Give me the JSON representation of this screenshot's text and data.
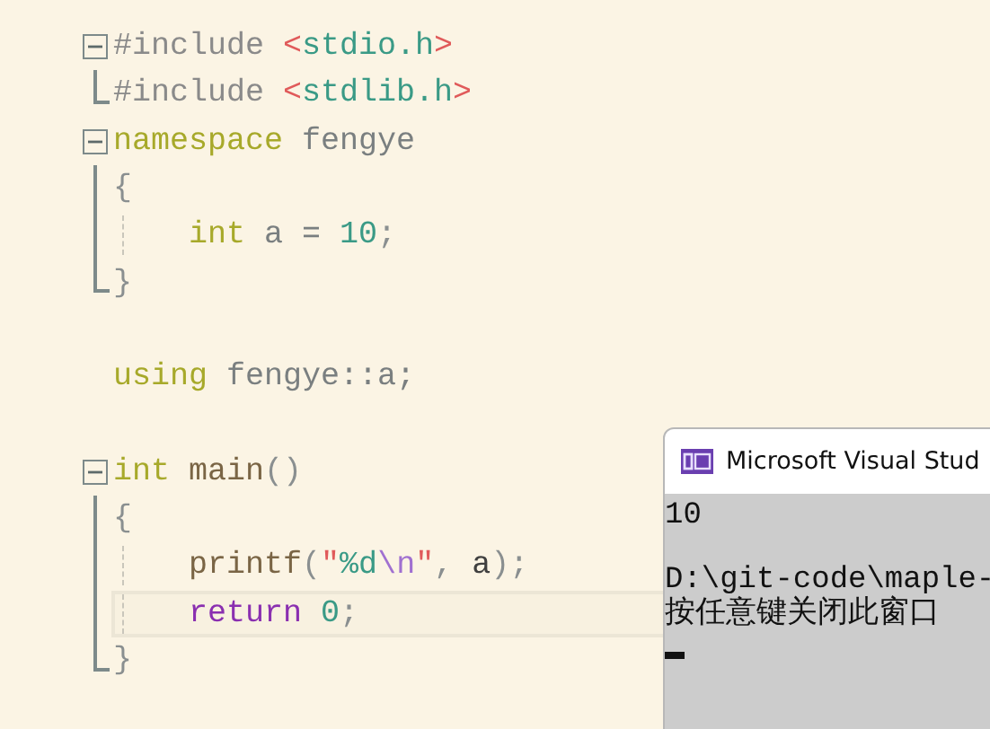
{
  "editor": {
    "lines": [
      {
        "kind": "fold_start",
        "selected": false,
        "tokens": [
          {
            "text": "#include ",
            "kind": "preproc"
          },
          {
            "text": "<",
            "kind": "bracket"
          },
          {
            "text": "stdio.h",
            "kind": "header"
          },
          {
            "text": ">",
            "kind": "bracket"
          }
        ]
      },
      {
        "kind": "fold_end",
        "selected": false,
        "tokens": [
          {
            "text": "#include ",
            "kind": "preproc"
          },
          {
            "text": "<",
            "kind": "bracket"
          },
          {
            "text": "stdlib.h",
            "kind": "header"
          },
          {
            "text": ">",
            "kind": "bracket"
          }
        ]
      },
      {
        "kind": "fold_start",
        "selected": false,
        "tokens": [
          {
            "text": "namespace",
            "kind": "keyword"
          },
          {
            "text": " fengye",
            "kind": "ident"
          }
        ]
      },
      {
        "kind": "fold_body",
        "selected": false,
        "tokens": [
          {
            "text": "{",
            "kind": "punct"
          }
        ]
      },
      {
        "kind": "fold_body",
        "selected": false,
        "indent": true,
        "tokens": [
          {
            "text": "int",
            "kind": "keyword"
          },
          {
            "text": " a = ",
            "kind": "ident"
          },
          {
            "text": "10",
            "kind": "number"
          },
          {
            "text": ";",
            "kind": "punct"
          }
        ]
      },
      {
        "kind": "fold_end",
        "selected": false,
        "tokens": [
          {
            "text": "}",
            "kind": "punct"
          }
        ]
      },
      {
        "kind": "plain",
        "selected": false
      },
      {
        "kind": "plain",
        "selected": false,
        "tokens": [
          {
            "text": "using",
            "kind": "keyword"
          },
          {
            "text": " fengye::a;",
            "kind": "ident"
          }
        ]
      },
      {
        "kind": "plain",
        "selected": false
      },
      {
        "kind": "fold_start",
        "selected": false,
        "tokens": [
          {
            "text": "int",
            "kind": "keyword"
          },
          {
            "text": " main",
            "kind": "func"
          },
          {
            "text": "()",
            "kind": "punct"
          }
        ]
      },
      {
        "kind": "fold_body",
        "selected": false,
        "tokens": [
          {
            "text": "{",
            "kind": "punct"
          }
        ]
      },
      {
        "kind": "fold_body",
        "selected": false,
        "indent": true,
        "tokens": [
          {
            "text": "printf",
            "kind": "func"
          },
          {
            "text": "(",
            "kind": "punct"
          },
          {
            "text": "\"",
            "kind": "bracket"
          },
          {
            "text": "%d",
            "kind": "header"
          },
          {
            "text": "\\n",
            "kind": "escape"
          },
          {
            "text": "\"",
            "kind": "bracket"
          },
          {
            "text": ", ",
            "kind": "punct"
          },
          {
            "text": "a",
            "kind": "var"
          },
          {
            "text": ");",
            "kind": "punct"
          }
        ]
      },
      {
        "kind": "fold_body",
        "selected": true,
        "indent": true,
        "tokens": [
          {
            "text": "return ",
            "kind": "control"
          },
          {
            "text": "0",
            "kind": "number"
          },
          {
            "text": ";",
            "kind": "punct"
          }
        ]
      },
      {
        "kind": "fold_end",
        "selected": false,
        "tokens": [
          {
            "text": "}",
            "kind": "punct"
          }
        ]
      }
    ]
  },
  "console": {
    "title": "Microsoft Visual Stud",
    "output": "10",
    "messages": [
      "D:\\git-code\\maple-",
      "按任意键关闭此窗口"
    ]
  }
}
